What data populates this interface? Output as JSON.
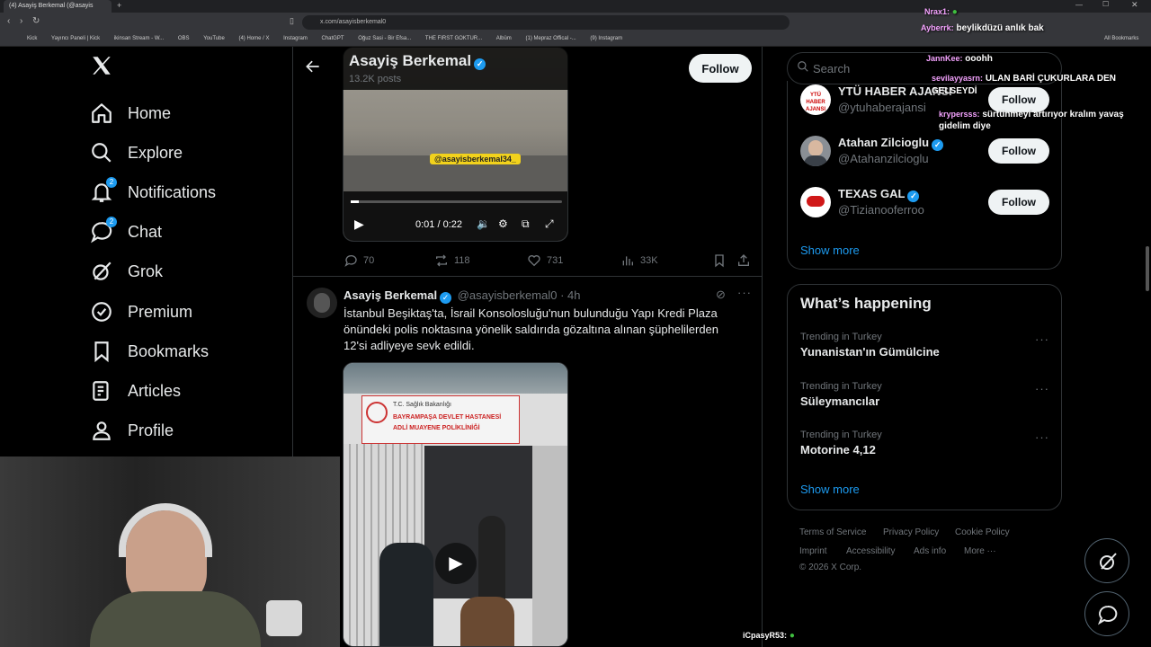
{
  "browser": {
    "tab_title": "(4) Asayiş Berkemal (@asayis",
    "url": "x.com/asayisberkemal0",
    "bookmarks": [
      "Kick",
      "Yayıncı Paneli | Kick",
      "ikinsan Stream - W...",
      "OBS",
      "YouTube",
      "(4) Home / X",
      "Instagram",
      "ChatGPT",
      "Oğuz Sasi - Bir Efsa...",
      "THE FIRST GOKTUR...",
      "Albüm",
      "(1) Mepraz Offical -...",
      "(9) Instagram"
    ],
    "all_bookmarks": "All Bookmarks"
  },
  "nav": {
    "items": [
      {
        "label": "Home",
        "icon": "home-icon"
      },
      {
        "label": "Explore",
        "icon": "search-icon"
      },
      {
        "label": "Notifications",
        "icon": "bell-icon",
        "badge": "2"
      },
      {
        "label": "Chat",
        "icon": "chat-bubble-icon",
        "badge": "2"
      },
      {
        "label": "Grok",
        "icon": "grok-icon"
      },
      {
        "label": "Premium",
        "icon": "verified-badge-icon"
      },
      {
        "label": "Bookmarks",
        "icon": "bookmark-icon"
      },
      {
        "label": "Articles",
        "icon": "article-icon"
      },
      {
        "label": "Profile",
        "icon": "person-icon"
      }
    ]
  },
  "header": {
    "name": "Asayiş Berkemal",
    "posts": "13.2K posts",
    "follow": "Follow"
  },
  "tweet1": {
    "watermark": "@asayisberkemal34_",
    "time": "0:01 / 0:22",
    "replies": "70",
    "reposts": "118",
    "likes": "731",
    "views": "33K"
  },
  "tweet2": {
    "name": "Asayiş Berkemal",
    "handle": "@asayisberkemal0",
    "time": "· 4h",
    "text": "İstanbul Beşiktaş'ta, İsrail Konsolosluğu'nun bulunduğu Yapı Kredi Plaza önündeki polis noktasına yönelik saldırıda gözaltına alınan şüphelilerden 12'si adliyeye sevk edildi.",
    "sign_line1": "T.C. Sağlık Bakanlığı",
    "sign_line2": "BAYRAMPAŞA DEVLET HASTANESİ",
    "sign_line3": "ADLİ MUAYENE POLİKLİNİĞİ"
  },
  "right": {
    "search_placeholder": "Search",
    "who_to_follow": [
      {
        "name": "YTÜ HABER AJANSI",
        "handle": "@ytuhaberajansi",
        "avatar_text": "YTÜ HABER AJANSI",
        "avatar_color": "#ffffff",
        "verified": false
      },
      {
        "name": "Atahan Zilcioglu",
        "handle": "@Atahanzilcioglu",
        "avatar_text": "",
        "avatar_color": "#8a8f95",
        "verified": true
      },
      {
        "name": "TEXAS GAL",
        "handle": "@Tizianooferroo",
        "avatar_text": "",
        "avatar_color": "#ffffff",
        "verified": true
      }
    ],
    "follow": "Follow",
    "show_more": "Show more",
    "happening_title": "What’s happening",
    "trends": [
      {
        "context": "Trending in Turkey",
        "name": "Yunanistan'ın Gümülcine"
      },
      {
        "context": "Trending in Turkey",
        "name": "Süleymancılar"
      },
      {
        "context": "Trending in Turkey",
        "name": "Motorine 4,12"
      }
    ],
    "footer": [
      "Terms of Service",
      "Privacy Policy",
      "Cookie Policy",
      "Imprint",
      "Accessibility",
      "Ads info",
      "More ···",
      "© 2026 X Corp."
    ]
  },
  "stream_chat": [
    {
      "user": "Nrax1:",
      "msg": ""
    },
    {
      "user": "Ayberrk:",
      "msg": "beylikdüzü anlık bak"
    },
    {
      "user": "JannKee:",
      "msg": "ooohh"
    },
    {
      "user": "sevilayyasrn:",
      "msg": "ULAN BARİ ÇUKURLARA DEN"
    },
    {
      "user": "",
      "msg": "GELSEYDİ"
    },
    {
      "user": "krypersss:",
      "msg": "sürtünmeyi artırıyor kralım yavaş"
    },
    {
      "user": "",
      "msg": "gidelim diye"
    },
    {
      "user": "iCpasyR53:",
      "msg": ""
    }
  ],
  "colors": {
    "accent": "#1d9bf0",
    "text": "#e7e9ea",
    "muted": "#71767b",
    "border": "#2f3336"
  }
}
